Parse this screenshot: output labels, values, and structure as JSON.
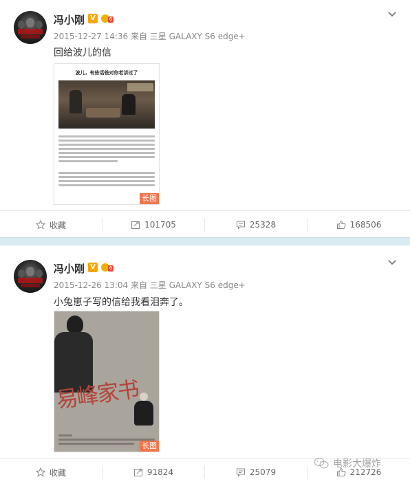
{
  "posts": [
    {
      "author": "冯小刚",
      "timestamp": "2015-12-27 14:36",
      "source": "来自 三星 GALAXY S6 edge+",
      "text": "回给波儿的信",
      "image": {
        "headline": "波儿，有些话爸对你老讲过了",
        "tag": "长图"
      },
      "actions": {
        "favorite": "收藏",
        "reposts": "101705",
        "comments": "25328",
        "likes": "168506"
      }
    },
    {
      "author": "冯小刚",
      "timestamp": "2015-12-26 13:04",
      "source": "来自 三星 GALAXY S6 edge+",
      "text": "小兔崽子写的信给我看泪奔了。",
      "image": {
        "headline": "易峰家书",
        "tag": "长图"
      },
      "actions": {
        "favorite": "收藏",
        "reposts": "91824",
        "comments": "25079",
        "likes": "212726"
      }
    }
  ],
  "watermark": {
    "text": "电影大爆炸"
  },
  "colors": {
    "divider": "#d8ecf1",
    "tag": "#f2744a",
    "verified": "#f7a600"
  }
}
